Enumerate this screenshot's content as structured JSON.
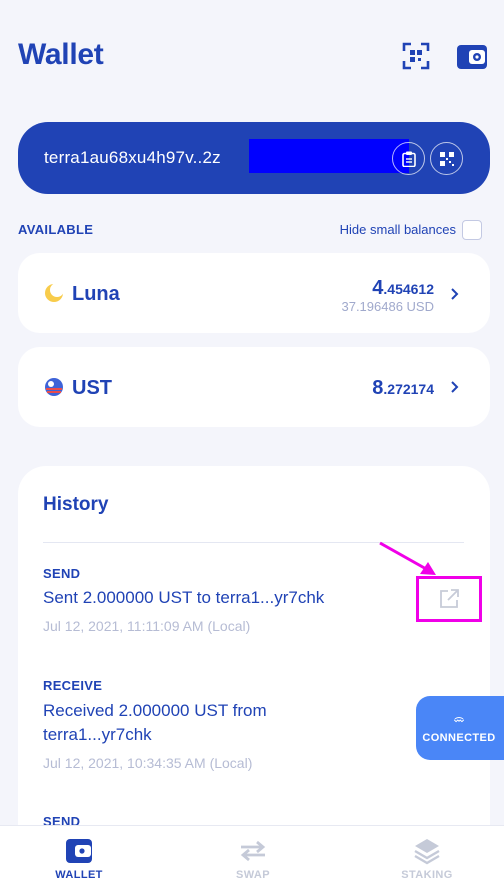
{
  "header": {
    "title": "Wallet",
    "qr_icon": "qr-scan-icon",
    "settings_icon": "wallet-settings-icon"
  },
  "address": {
    "text": "terra1au68xu4h97v..2z",
    "copy_icon": "clipboard-icon",
    "qr_icon": "qr-code-icon",
    "redaction_color": "#0000ff"
  },
  "available": {
    "label": "AVAILABLE",
    "hide_small_label": "Hide small balances",
    "hide_small_checked": false
  },
  "assets": [
    {
      "name": "Luna",
      "icon": "luna-token-icon",
      "amount_int": "4",
      "amount_dec": ".454612",
      "usd": "37.196486 USD"
    },
    {
      "name": "UST",
      "icon": "ust-token-icon",
      "amount_int": "8",
      "amount_dec": ".272174",
      "usd": ""
    }
  ],
  "history": {
    "title": "History",
    "items": [
      {
        "type": "SEND",
        "message": "Sent 2.000000 UST to terra1...yr7chk",
        "date": "Jul 12, 2021, 11:11:09 AM (Local)"
      },
      {
        "type": "RECEIVE",
        "message": "Received 2.000000 UST from terra1...yr7chk",
        "date": "Jul 12, 2021, 10:34:35 AM (Local)"
      },
      {
        "type": "SEND",
        "message": "",
        "date": ""
      }
    ]
  },
  "connected": {
    "label": "CONNECTED",
    "icon": "walletconnect-icon"
  },
  "tabs": [
    {
      "label": "WALLET",
      "icon": "wallet-tab-icon",
      "active": true
    },
    {
      "label": "SWAP",
      "icon": "swap-icon",
      "active": false
    },
    {
      "label": "STAKING",
      "icon": "staking-layers-icon",
      "active": false
    }
  ],
  "colors": {
    "primary": "#2043b5",
    "background": "#f4f5fb",
    "connected_blue": "#4a86f7",
    "highlight_magenta": "#f000e8",
    "muted": "#a0a9cc"
  }
}
